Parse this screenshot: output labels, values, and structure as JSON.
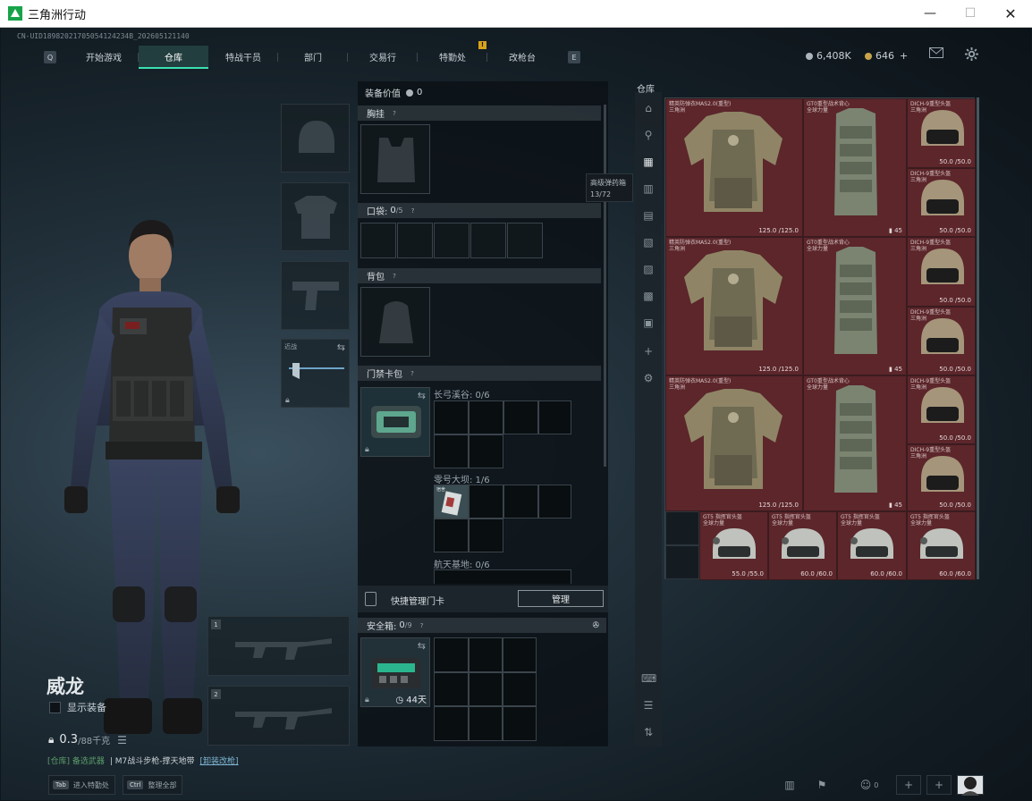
{
  "window": {
    "title": "三角洲行动",
    "controls": [
      "—",
      "☐",
      "✕"
    ]
  },
  "uid": "CN-UID18982021705054124234B_202605121140",
  "nav": {
    "left_key": "Q",
    "right_key": "E",
    "tabs": [
      "开始游戏",
      "仓库",
      "特战干员",
      "部门",
      "交易行",
      "特勤处",
      "改枪台"
    ],
    "active": "仓库",
    "alert": "!"
  },
  "currency": {
    "coins": "6,408K",
    "tickets": "646",
    "plus": "+"
  },
  "operator": {
    "name": "威龙",
    "show_equipment": "显示装备",
    "weight_value": "0.3",
    "weight_max": "/88千克"
  },
  "weapon_note": {
    "prefix": "[仓库] 备选武器",
    "text": "| M7战斗步枪-撑天地带",
    "link": "[卸装改枪]"
  },
  "bottom_hints": [
    {
      "key": "Tab",
      "label": "进入特勤处"
    },
    {
      "key": "Ctrl",
      "label": "整理全部"
    }
  ],
  "slots": {
    "melee_label": "近战",
    "weapon1_num": "1",
    "weapon2_num": "2"
  },
  "equipment": {
    "value_label": "装备价值",
    "value": "0",
    "chest_rig": "胸挂",
    "pockets": "口袋:",
    "pockets_count": "0",
    "pockets_max": "/5",
    "backpack": "背包",
    "keycard_bag": "门禁卡包",
    "grid_long_valley": "长弓溪谷: 0/6",
    "grid_zero_dam": "零号大坝: 1/6",
    "grid_space_base": "航天基地: 0/6",
    "keycard_item_label": "宿舍",
    "quick_manage": "快捷管理门卡",
    "manage_btn": "管理",
    "safe_box": "安全箱:",
    "safe_count": "0",
    "safe_max": "/9",
    "safe_days": "44天"
  },
  "tooltip": {
    "title": "高级弹药箱",
    "count": "13/72"
  },
  "warehouse": {
    "label": "仓库",
    "items": [
      {
        "name": "精英防弹衣MAS2.0(重型)",
        "sub": "三角洲",
        "dur": "125.0 /125.0",
        "kind": "armor"
      },
      {
        "name": "GT0重型战术背心",
        "sub": "全球力量",
        "count": "45",
        "kind": "rig"
      },
      {
        "name": "DICH-9重型头盔",
        "sub": "三角洲",
        "dur": "50.0 /50.0",
        "kind": "helmet"
      },
      {
        "name": "DICH-9重型头盔",
        "sub": "三角洲",
        "dur": "50.0 /50.0",
        "kind": "helmet"
      },
      {
        "name": "精英防弹衣MAS2.0(重型)",
        "sub": "三角洲",
        "dur": "125.0 /125.0",
        "kind": "armor"
      },
      {
        "name": "GT0重型战术背心",
        "sub": "全球力量",
        "count": "45",
        "kind": "rig"
      },
      {
        "name": "DICH-9重型头盔",
        "sub": "三角洲",
        "dur": "50.0 /50.0",
        "kind": "helmet"
      },
      {
        "name": "DICH-9重型头盔",
        "sub": "三角洲",
        "dur": "50.0 /50.0",
        "kind": "helmet"
      },
      {
        "name": "精英防弹衣MAS2.0(重型)",
        "sub": "三角洲",
        "dur": "125.0 /125.0",
        "kind": "armor"
      },
      {
        "name": "GT0重型战术背心",
        "sub": "全球力量",
        "count": "45",
        "kind": "rig"
      },
      {
        "name": "DICH-9重型头盔",
        "sub": "三角洲",
        "dur": "50.0 /50.0",
        "kind": "helmet"
      },
      {
        "name": "DICH-9重型头盔",
        "sub": "三角洲",
        "dur": "50.0 /50.0",
        "kind": "helmet"
      },
      {
        "name": "GT5 指挥官头盔",
        "sub": "全球力量",
        "dur": "55.0 /55.0",
        "kind": "helmet2"
      },
      {
        "name": "GT5 指挥官头盔",
        "sub": "全球力量",
        "dur": "60.0 /60.0",
        "kind": "helmet2"
      },
      {
        "name": "GT5 指挥官头盔",
        "sub": "全球力量",
        "dur": "60.0 /60.0",
        "kind": "helmet2"
      },
      {
        "name": "GT5 指挥官头盔",
        "sub": "全球力量",
        "dur": "60.0 /60.0",
        "kind": "helmet2"
      }
    ]
  },
  "bottom_right": {
    "friends": "0"
  },
  "colors": {
    "accent": "#3be0b0",
    "item_bg": "#5c262b",
    "panel": "#0c1216"
  },
  "icons": [
    "settings-icon",
    "mail-icon",
    "lock-icon",
    "swap-icon",
    "pin-icon",
    "clock-icon",
    "plus-icon",
    "stats-icon",
    "friends-icon",
    "avatar"
  ]
}
